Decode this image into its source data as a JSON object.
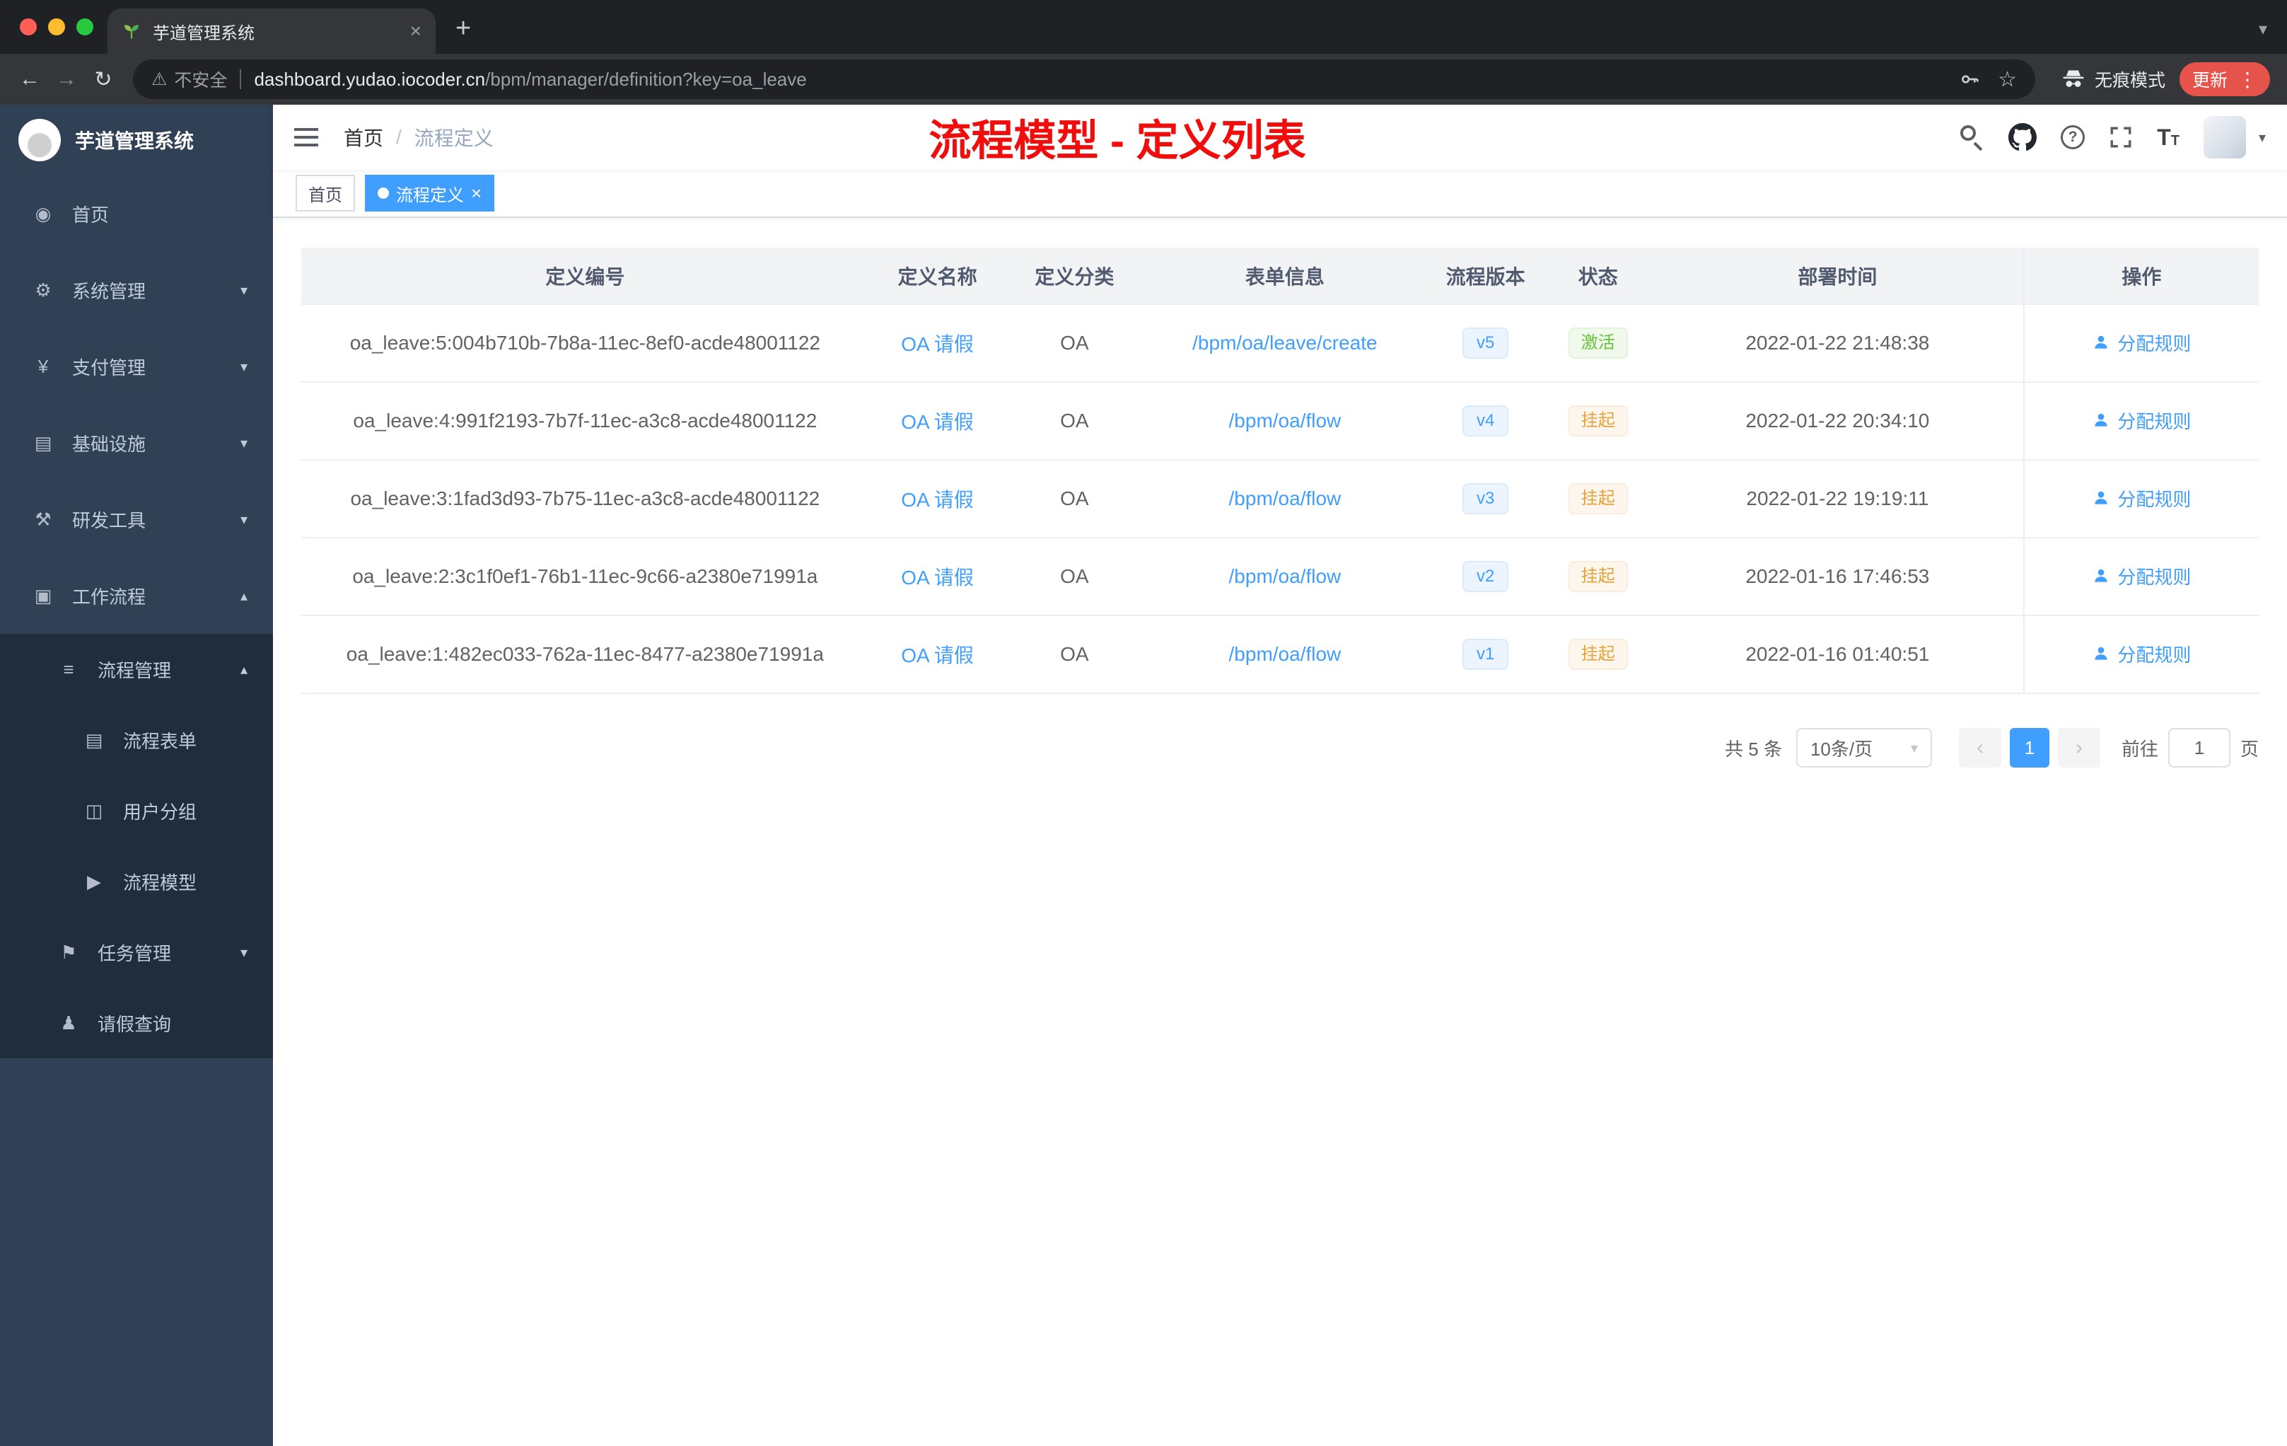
{
  "colors": {
    "accent_blue": "#409eff",
    "success_green": "#67c23a",
    "warning_orange": "#e6a23c",
    "annotation_red": "#f20d0d",
    "sidebar_bg": "#304156",
    "submenu_bg": "#1f2d3d",
    "update_pill_red": "#e5534b"
  },
  "browser": {
    "tab_title": "芋道管理系统",
    "close_tab": "×",
    "new_tab": "+",
    "tab_chevron": "▾",
    "back": "←",
    "forward": "→",
    "reload": "↻",
    "warning_glyph": "⚠",
    "security_label": "不安全",
    "url_host": "dashboard.yudao.iocoder.cn",
    "url_path": "/bpm/manager/definition?key=oa_leave",
    "star": "☆",
    "incognito_label": "无痕模式",
    "update_label": "更新",
    "kebab": "⋮"
  },
  "sidebar": {
    "app_title": "芋道管理系统",
    "items": [
      {
        "glyph": "◉",
        "label": "首页",
        "chevron": ""
      },
      {
        "glyph": "⚙",
        "label": "系统管理",
        "chevron": "▾"
      },
      {
        "glyph": "¥",
        "label": "支付管理",
        "chevron": "▾"
      },
      {
        "glyph": "▤",
        "label": "基础设施",
        "chevron": "▾"
      },
      {
        "glyph": "⚒",
        "label": "研发工具",
        "chevron": "▾"
      },
      {
        "glyph": "▣",
        "label": "工作流程",
        "chevron": "▴"
      },
      {
        "glyph": "≡",
        "label": "流程管理",
        "chevron": "▴"
      },
      {
        "glyph": "▤",
        "label": "流程表单",
        "chevron": ""
      },
      {
        "glyph": "◫",
        "label": "用户分组",
        "chevron": ""
      },
      {
        "glyph": "▶",
        "label": "流程模型",
        "chevron": ""
      },
      {
        "glyph": "⚑",
        "label": "任务管理",
        "chevron": "▾"
      },
      {
        "glyph": "♟",
        "label": "请假查询",
        "chevron": ""
      }
    ]
  },
  "navbar": {
    "breadcrumb": {
      "home": "首页",
      "separator": "/",
      "current": "流程定义"
    },
    "annotation": "流程模型 - 定义列表",
    "help_glyph": "?",
    "textsize_large": "T",
    "textsize_small": "T",
    "avatar_caret": "▾"
  },
  "tags": {
    "home": "首页",
    "active": "流程定义",
    "close": "×"
  },
  "table": {
    "headers": [
      "定义编号",
      "定义名称",
      "定义分类",
      "表单信息",
      "流程版本",
      "状态",
      "部署时间",
      "操作"
    ],
    "rows": [
      {
        "id": "oa_leave:5:004b710b-7b8a-11ec-8ef0-acde48001122",
        "name": "OA 请假",
        "category": "OA",
        "form": "/bpm/oa/leave/create",
        "version": "v5",
        "status": "激活",
        "deploy_time": "2022-01-22 21:48:38",
        "action": "分配规则"
      },
      {
        "id": "oa_leave:4:991f2193-7b7f-11ec-a3c8-acde48001122",
        "name": "OA 请假",
        "category": "OA",
        "form": "/bpm/oa/flow",
        "version": "v4",
        "status": "挂起",
        "deploy_time": "2022-01-22 20:34:10",
        "action": "分配规则"
      },
      {
        "id": "oa_leave:3:1fad3d93-7b75-11ec-a3c8-acde48001122",
        "name": "OA 请假",
        "category": "OA",
        "form": "/bpm/oa/flow",
        "version": "v3",
        "status": "挂起",
        "deploy_time": "2022-01-22 19:19:11",
        "action": "分配规则"
      },
      {
        "id": "oa_leave:2:3c1f0ef1-76b1-11ec-9c66-a2380e71991a",
        "name": "OA 请假",
        "category": "OA",
        "form": "/bpm/oa/flow",
        "version": "v2",
        "status": "挂起",
        "deploy_time": "2022-01-16 17:46:53",
        "action": "分配规则"
      },
      {
        "id": "oa_leave:1:482ec033-762a-11ec-8477-a2380e71991a",
        "name": "OA 请假",
        "category": "OA",
        "form": "/bpm/oa/flow",
        "version": "v1",
        "status": "挂起",
        "deploy_time": "2022-01-16 01:40:51",
        "action": "分配规则"
      }
    ]
  },
  "pagination": {
    "total": "共 5 条",
    "page_size": "10条/页",
    "select_caret": "▾",
    "prev": "‹",
    "page": "1",
    "next": "›",
    "goto_label": "前往",
    "goto_value": "1",
    "unit": "页"
  }
}
